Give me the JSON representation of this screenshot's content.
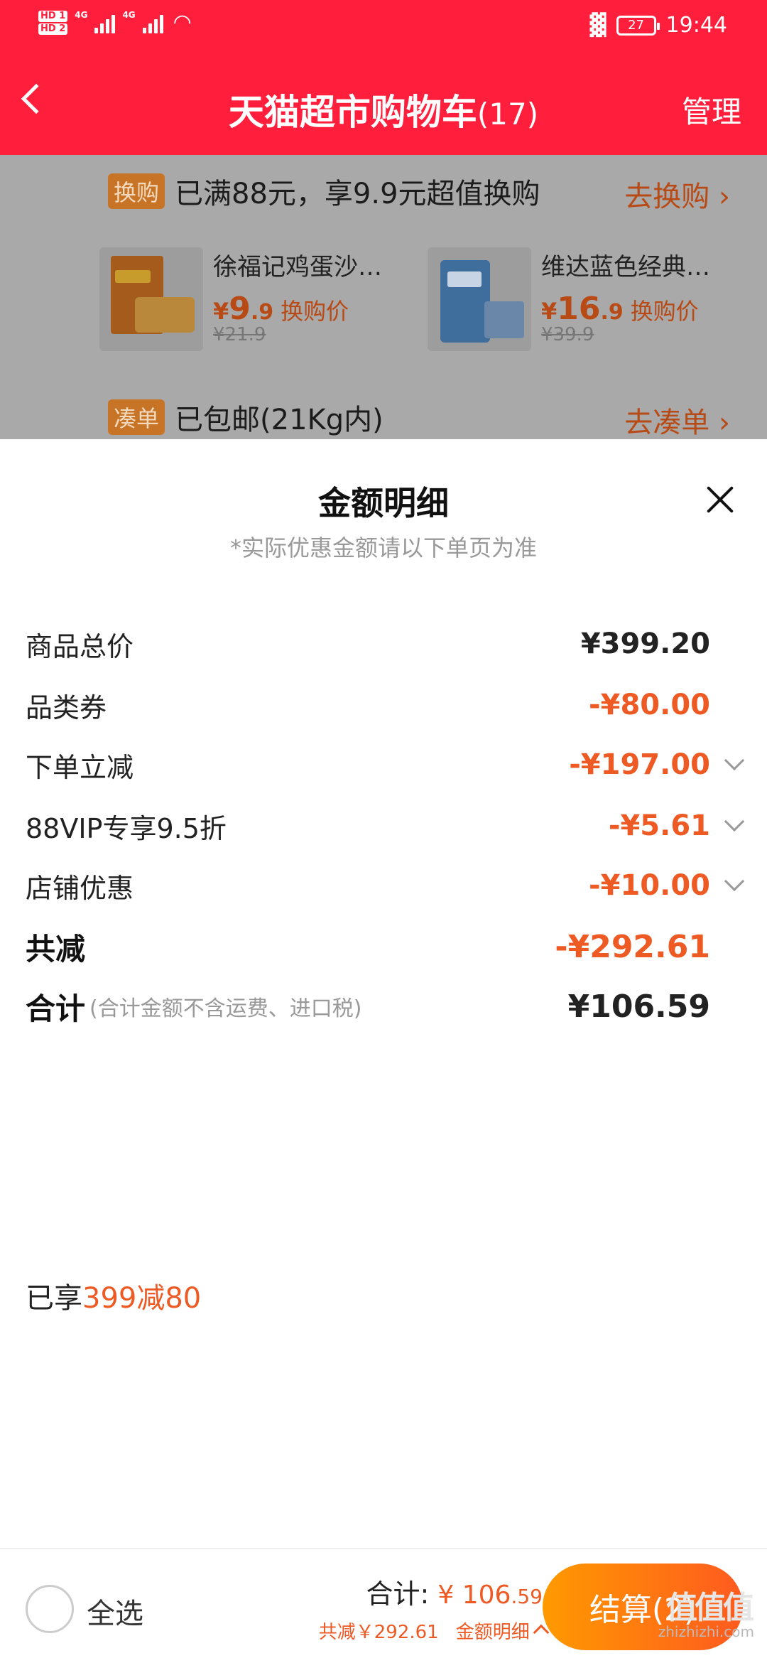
{
  "status_bar": {
    "hd1": "HD 1",
    "hd2": "HD 2",
    "net1": "4G",
    "net2": "4G",
    "battery": "27",
    "time": "19:44"
  },
  "header": {
    "title": "天猫超市购物车",
    "count": "(17)",
    "manage": "管理"
  },
  "promo": {
    "swap_tag": "换购",
    "swap_text": "已满88元，享9.9元超值换购",
    "swap_link": "去换购 ›",
    "products": [
      {
        "name": "徐福记鸡蛋沙…",
        "currency": "¥",
        "price_int": "9",
        "price_dec": ".9",
        "price_label": "换购价",
        "orig": "¥21.9"
      },
      {
        "name": "维达蓝色经典…",
        "currency": "¥",
        "price_int": "16",
        "price_dec": ".9",
        "price_label": "换购价",
        "orig": "¥39.9"
      }
    ],
    "bundle_tag": "凑单",
    "bundle_text": "已包邮(21Kg内)",
    "bundle_link": "去凑单 ›"
  },
  "sheet": {
    "title": "金额明细",
    "subtitle": "*实际优惠金额请以下单页为准",
    "rows": [
      {
        "label": "商品总价",
        "value": "¥399.20"
      },
      {
        "label": "品类券",
        "value": "-¥80.00"
      },
      {
        "label": "下单立减",
        "value": "-¥197.00"
      },
      {
        "label": "88VIP专享9.5折",
        "value": "-¥5.61"
      },
      {
        "label": "店铺优惠",
        "value": "-¥10.00"
      }
    ],
    "total_saved_label": "共减",
    "total_saved_value": "-¥292.61",
    "sum_label": "合计",
    "sum_note": "(合计金额不含运费、进口税)",
    "sum_value": "¥106.59",
    "enjoyed_prefix": "已享",
    "enjoyed_highlight": "399减80"
  },
  "bottom_bar": {
    "select_all": "全选",
    "total_label": "合计:",
    "total_currency": "¥",
    "total_int": "106",
    "total_dec": ".59",
    "saved": "共减￥292.61",
    "detail_link": "金额明细",
    "checkout": "结算(2)"
  },
  "watermark": {
    "logo": "值值值",
    "url": "zhizhizhi.com"
  },
  "colors": {
    "header_red": "#ff1f3d",
    "accent_orange": "#ee5a24",
    "checkout_gradient_start": "#ff9a00",
    "checkout_gradient_end": "#ff5a1f"
  }
}
